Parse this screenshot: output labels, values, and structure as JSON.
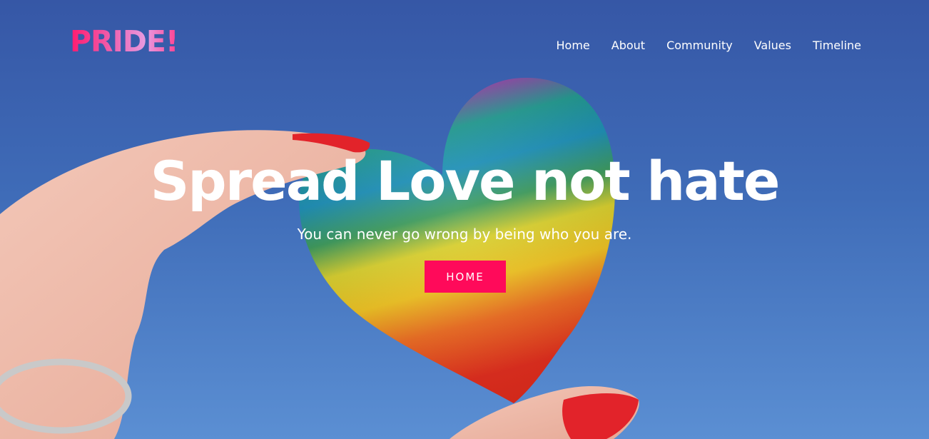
{
  "brand": {
    "logo_text": "PRIDE!"
  },
  "nav": {
    "items": [
      "Home",
      "About",
      "Community",
      "Values",
      "Timeline"
    ]
  },
  "hero": {
    "headline": "Spread Love not hate",
    "subline": "You can never go wrong by being who you are.",
    "cta_label": "HOME",
    "image_alt": "hand-holding-rainbow-heart"
  },
  "colors": {
    "accent": "#ff0a5a",
    "sky": "#3f6cb8",
    "logo_gradient": [
      "#ff1a6e",
      "#e79be0"
    ]
  }
}
